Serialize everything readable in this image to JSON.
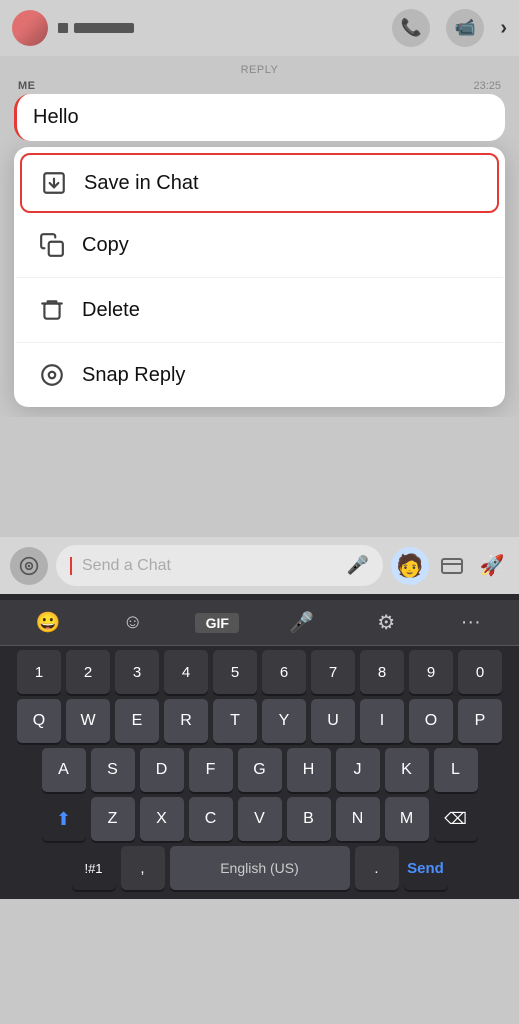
{
  "topbar": {
    "username": "·  ·····",
    "icons": {
      "phone": "📞",
      "video": "📹",
      "chevron": "›"
    }
  },
  "chat": {
    "reply_label": "REPLY",
    "message": {
      "sender": "ME",
      "time": "23:25",
      "text": "Hello"
    }
  },
  "context_menu": {
    "items": [
      {
        "id": "save-in-chat",
        "label": "Save in Chat",
        "icon": "⬇",
        "highlighted": true
      },
      {
        "id": "copy",
        "label": "Copy",
        "icon": "⧉",
        "highlighted": false
      },
      {
        "id": "delete",
        "label": "Delete",
        "icon": "◇",
        "highlighted": false
      },
      {
        "id": "snap-reply",
        "label": "Snap Reply",
        "icon": "◎",
        "highlighted": false
      }
    ]
  },
  "input_bar": {
    "placeholder": "Send a Chat",
    "camera_icon": "📷",
    "mic_icon": "🎤",
    "bitmoji": "🧑",
    "card_icon": "🎴",
    "rocket_icon": "🚀"
  },
  "keyboard": {
    "toolbar_icons": [
      "😀",
      "☺",
      "GIF",
      "🎤",
      "⚙",
      "···"
    ],
    "number_row": [
      "1",
      "2",
      "3",
      "4",
      "5",
      "6",
      "7",
      "8",
      "9",
      "0"
    ],
    "row_q": [
      "Q",
      "W",
      "E",
      "R",
      "T",
      "Y",
      "U",
      "I",
      "O",
      "P"
    ],
    "row_a": [
      "A",
      "S",
      "D",
      "F",
      "G",
      "H",
      "J",
      "K",
      "L"
    ],
    "row_z": [
      "Z",
      "X",
      "C",
      "V",
      "B",
      "N",
      "M"
    ],
    "special": {
      "shift": "⬆",
      "delete": "⌫",
      "symbols": "!#1",
      "comma": ",",
      "language": "English (US)",
      "period": ".",
      "send": "Send"
    }
  }
}
